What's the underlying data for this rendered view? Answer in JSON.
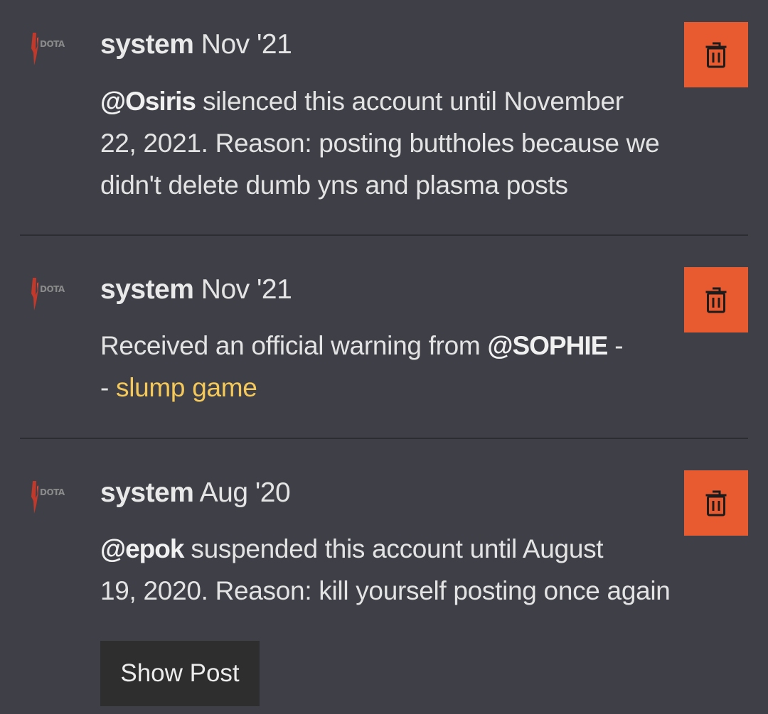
{
  "posts": [
    {
      "user": "system",
      "date": "Nov '21",
      "avatar_icon": "dota-logo-avatar",
      "delete_icon": "trash-icon",
      "line1_mention": "@Osiris",
      "line1_text": " silenced this account until November",
      "line2": "22, 2021. Reason: posting buttholes because we",
      "line3": "didn't delete dumb yns and plasma posts"
    },
    {
      "user": "system",
      "date": "Nov '21",
      "avatar_icon": "dota-logo-avatar",
      "delete_icon": "trash-icon",
      "line1_text": "Received an official warning from ",
      "line1_mention": "@SOPHIE",
      "line1_suffix": " -",
      "line2_prefix": "- ",
      "line2_link": "slump game"
    },
    {
      "user": "system",
      "date": "Aug '20",
      "avatar_icon": "dota-logo-avatar",
      "delete_icon": "trash-icon",
      "line1_mention": "@epok",
      "line1_text": " suspended this account until August",
      "line2": "19, 2020. Reason: kill yourself posting once again",
      "show_post_label": "Show Post"
    }
  ],
  "colors": {
    "background": "#3f4047",
    "delete_button": "#e85a30",
    "link": "#f5c85a",
    "show_post_button": "#2e2e2e"
  }
}
